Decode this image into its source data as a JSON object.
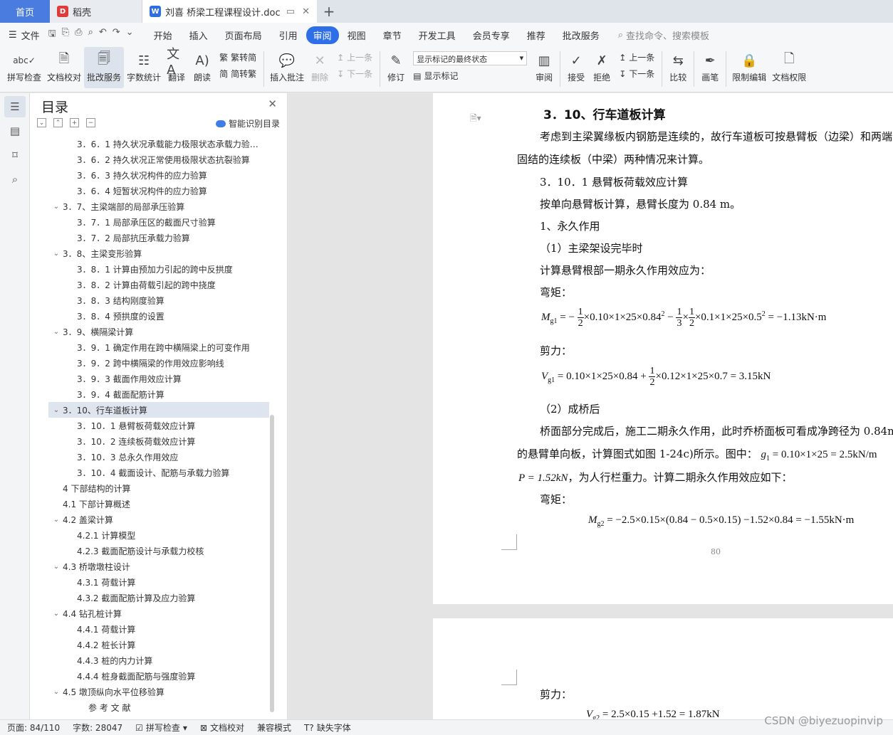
{
  "tabs": {
    "home": "首页",
    "daoke": "稻壳",
    "document": "刘喜 桥梁工程课程设计.doc"
  },
  "menu": {
    "file": "文件",
    "items": [
      "开始",
      "插入",
      "页面布局",
      "引用",
      "审阅",
      "视图",
      "章节",
      "开发工具",
      "会员专享",
      "推荐",
      "批改服务"
    ],
    "search": "查找命令、搜索模板"
  },
  "ribbon": {
    "spell_check": "拼写检查",
    "doc_proof": "文档校对",
    "review_service": "批改服务",
    "word_count": "字数统计",
    "translate": "翻译",
    "read_aloud": "朗读",
    "to_traditional": "繁转简",
    "to_simplified": "简转繁",
    "insert_comment": "插入批注",
    "delete": "删除",
    "prev": "上一条",
    "next": "下一条",
    "revise": "修订",
    "markup_select": "显示标记的最终状态",
    "show_markup": "显示标记",
    "review_pane": "审阅",
    "accept": "接受",
    "reject": "拒绝",
    "prev2": "上一条",
    "next2": "下一条",
    "compare": "比较",
    "pen": "画笔",
    "restrict_edit": "限制编辑",
    "doc_permission": "文档权限"
  },
  "toc": {
    "title": "目录",
    "smart": "智能识别目录",
    "items": [
      {
        "text": "3．6．1 持久状况承载能力极限状态承载力验…",
        "level": 3
      },
      {
        "text": "3．6．2 持久状况正常使用极限状态抗裂验算",
        "level": 3
      },
      {
        "text": "3．6．3 持久状况构件的应力验算",
        "level": 3
      },
      {
        "text": "3．6．4 短暂状况构件的应力验算",
        "level": 3
      },
      {
        "text": "3．7、主梁端部的局部承压验算",
        "level": 2
      },
      {
        "text": "3．7．1 局部承压区的截面尺寸验算",
        "level": 3
      },
      {
        "text": "3．7．2 局部抗压承载力验算",
        "level": 3
      },
      {
        "text": "3．8、主梁变形验算",
        "level": 2
      },
      {
        "text": "3．8．1 计算由预加力引起的跨中反拱度",
        "level": 3
      },
      {
        "text": "3．8．2 计算由荷载引起的跨中挠度",
        "level": 3
      },
      {
        "text": "3．8．3 结构刚度验算",
        "level": 3
      },
      {
        "text": "3．8．4 预拱度的设置",
        "level": 3
      },
      {
        "text": "3．9、横隔梁计算",
        "level": 2
      },
      {
        "text": "3．9．1 确定作用在跨中横隔梁上的可变作用",
        "level": 3
      },
      {
        "text": "3．9．2 跨中横隔梁的作用效应影响线",
        "level": 3
      },
      {
        "text": "3．9．3 截面作用效应计算",
        "level": 3
      },
      {
        "text": "3．9．4 截面配筋计算",
        "level": 3
      },
      {
        "text": "3．10、行车道板计算",
        "level": 2,
        "selected": true
      },
      {
        "text": "3．10．1 悬臂板荷载效应计算",
        "level": 3
      },
      {
        "text": "3．10．2 连续板荷载效应计算",
        "level": 3
      },
      {
        "text": "3．10．3 总永久作用效应",
        "level": 3
      },
      {
        "text": "3．10．4 截面设计、配筋与承载力验算",
        "level": 3
      },
      {
        "text": "4 下部结构的计算",
        "level": 1
      },
      {
        "text": "4.1 下部计算概述",
        "level": 1
      },
      {
        "text": "4.2 盖梁计算",
        "level": 2
      },
      {
        "text": "4.2.1 计算模型",
        "level": 3
      },
      {
        "text": "4.2.3 截面配筋设计与承载力校核",
        "level": 3
      },
      {
        "text": "4.3 桥墩墩柱设计",
        "level": 2
      },
      {
        "text": "4.3.1 荷载计算",
        "level": 3
      },
      {
        "text": "4.3.2 截面配筋计算及应力验算",
        "level": 3
      },
      {
        "text": "4.4 钻孔桩计算",
        "level": 2
      },
      {
        "text": "4.4.1 荷载计算",
        "level": 3
      },
      {
        "text": "4.4.2 桩长计算",
        "level": 3
      },
      {
        "text": "4.4.3 桩的内力计算",
        "level": 3
      },
      {
        "text": "4.4.4 桩身截面配筋与强度验算",
        "level": 3
      },
      {
        "text": "4.5 墩顶纵向水平位移验算",
        "level": 2
      },
      {
        "text": "参 考 文 献",
        "level": 4
      }
    ]
  },
  "doc": {
    "heading": "3．10、行车道板计算",
    "p1": "考虑到主梁翼缘板内钢筋是连续的，故行车道板可按悬臂板（边梁）和两端",
    "p1b": "固结的连续板（中梁）两种情况来计算。",
    "sub1": "3．10．1 悬臂板荷载效应计算",
    "p2": "按单向悬臂板计算，悬臂长度为 0.84 m。",
    "p3": "1、永久作用",
    "p4": "（1）主梁架设完毕时",
    "p5": "计算悬臂根部一期永久作用效应为：",
    "p6": "弯矩：",
    "eq1_lhs": "M",
    "eq1_sub": "g1",
    "eq1_a": "= −",
    "eq1_b": "×0.10×1×25×0.84",
    "eq1_c": " − ",
    "eq1_d": "×0.1×1×25×0.5",
    "eq1_e": " = −1.13kN·m",
    "p7": "剪力：",
    "eq2_lhs": "V",
    "eq2_sub": "g1",
    "eq2_a": "= 0.10×1×25×0.84 +",
    "eq2_b": "×0.12×1×25×0.7 = 3.15kN",
    "p8": "（2）成桥后",
    "p9": "桥面部分完成后，施工二期永久作用，此时乔桥面板可看成净跨径为 0.84m",
    "p10": "的悬臂单向板，计算图式如图 1-24c)所示。图中：",
    "eq3": "g",
    "eq3_sub": "1",
    "eq3_rest": " = 0.10×1×25 = 2.5kN/m",
    "p11a": "P = 1.52kN",
    "p11b": "，为人行栏重力。计算二期永久作用效应如下：",
    "p12": "弯矩：",
    "eq4_lhs": "M",
    "eq4_sub": "g2",
    "eq4_rest": " = −2.5×0.15×(0.84 − 0.5×0.15) −1.52×0.84 = −1.55kN·m",
    "pagenum": "80",
    "p13": "剪力：",
    "eq5_lhs": "V",
    "eq5_sub": "g2",
    "eq5_rest": " = 2.5×0.15 +1.52 = 1.87kN"
  },
  "status": {
    "page": "页面: 84/110",
    "words": "字数: 28047",
    "spell": "拼写检查",
    "proof": "文档校对",
    "compat": "兼容模式",
    "missing_font": "缺失字体"
  },
  "watermark": "CSDN @biyezuopinvip"
}
